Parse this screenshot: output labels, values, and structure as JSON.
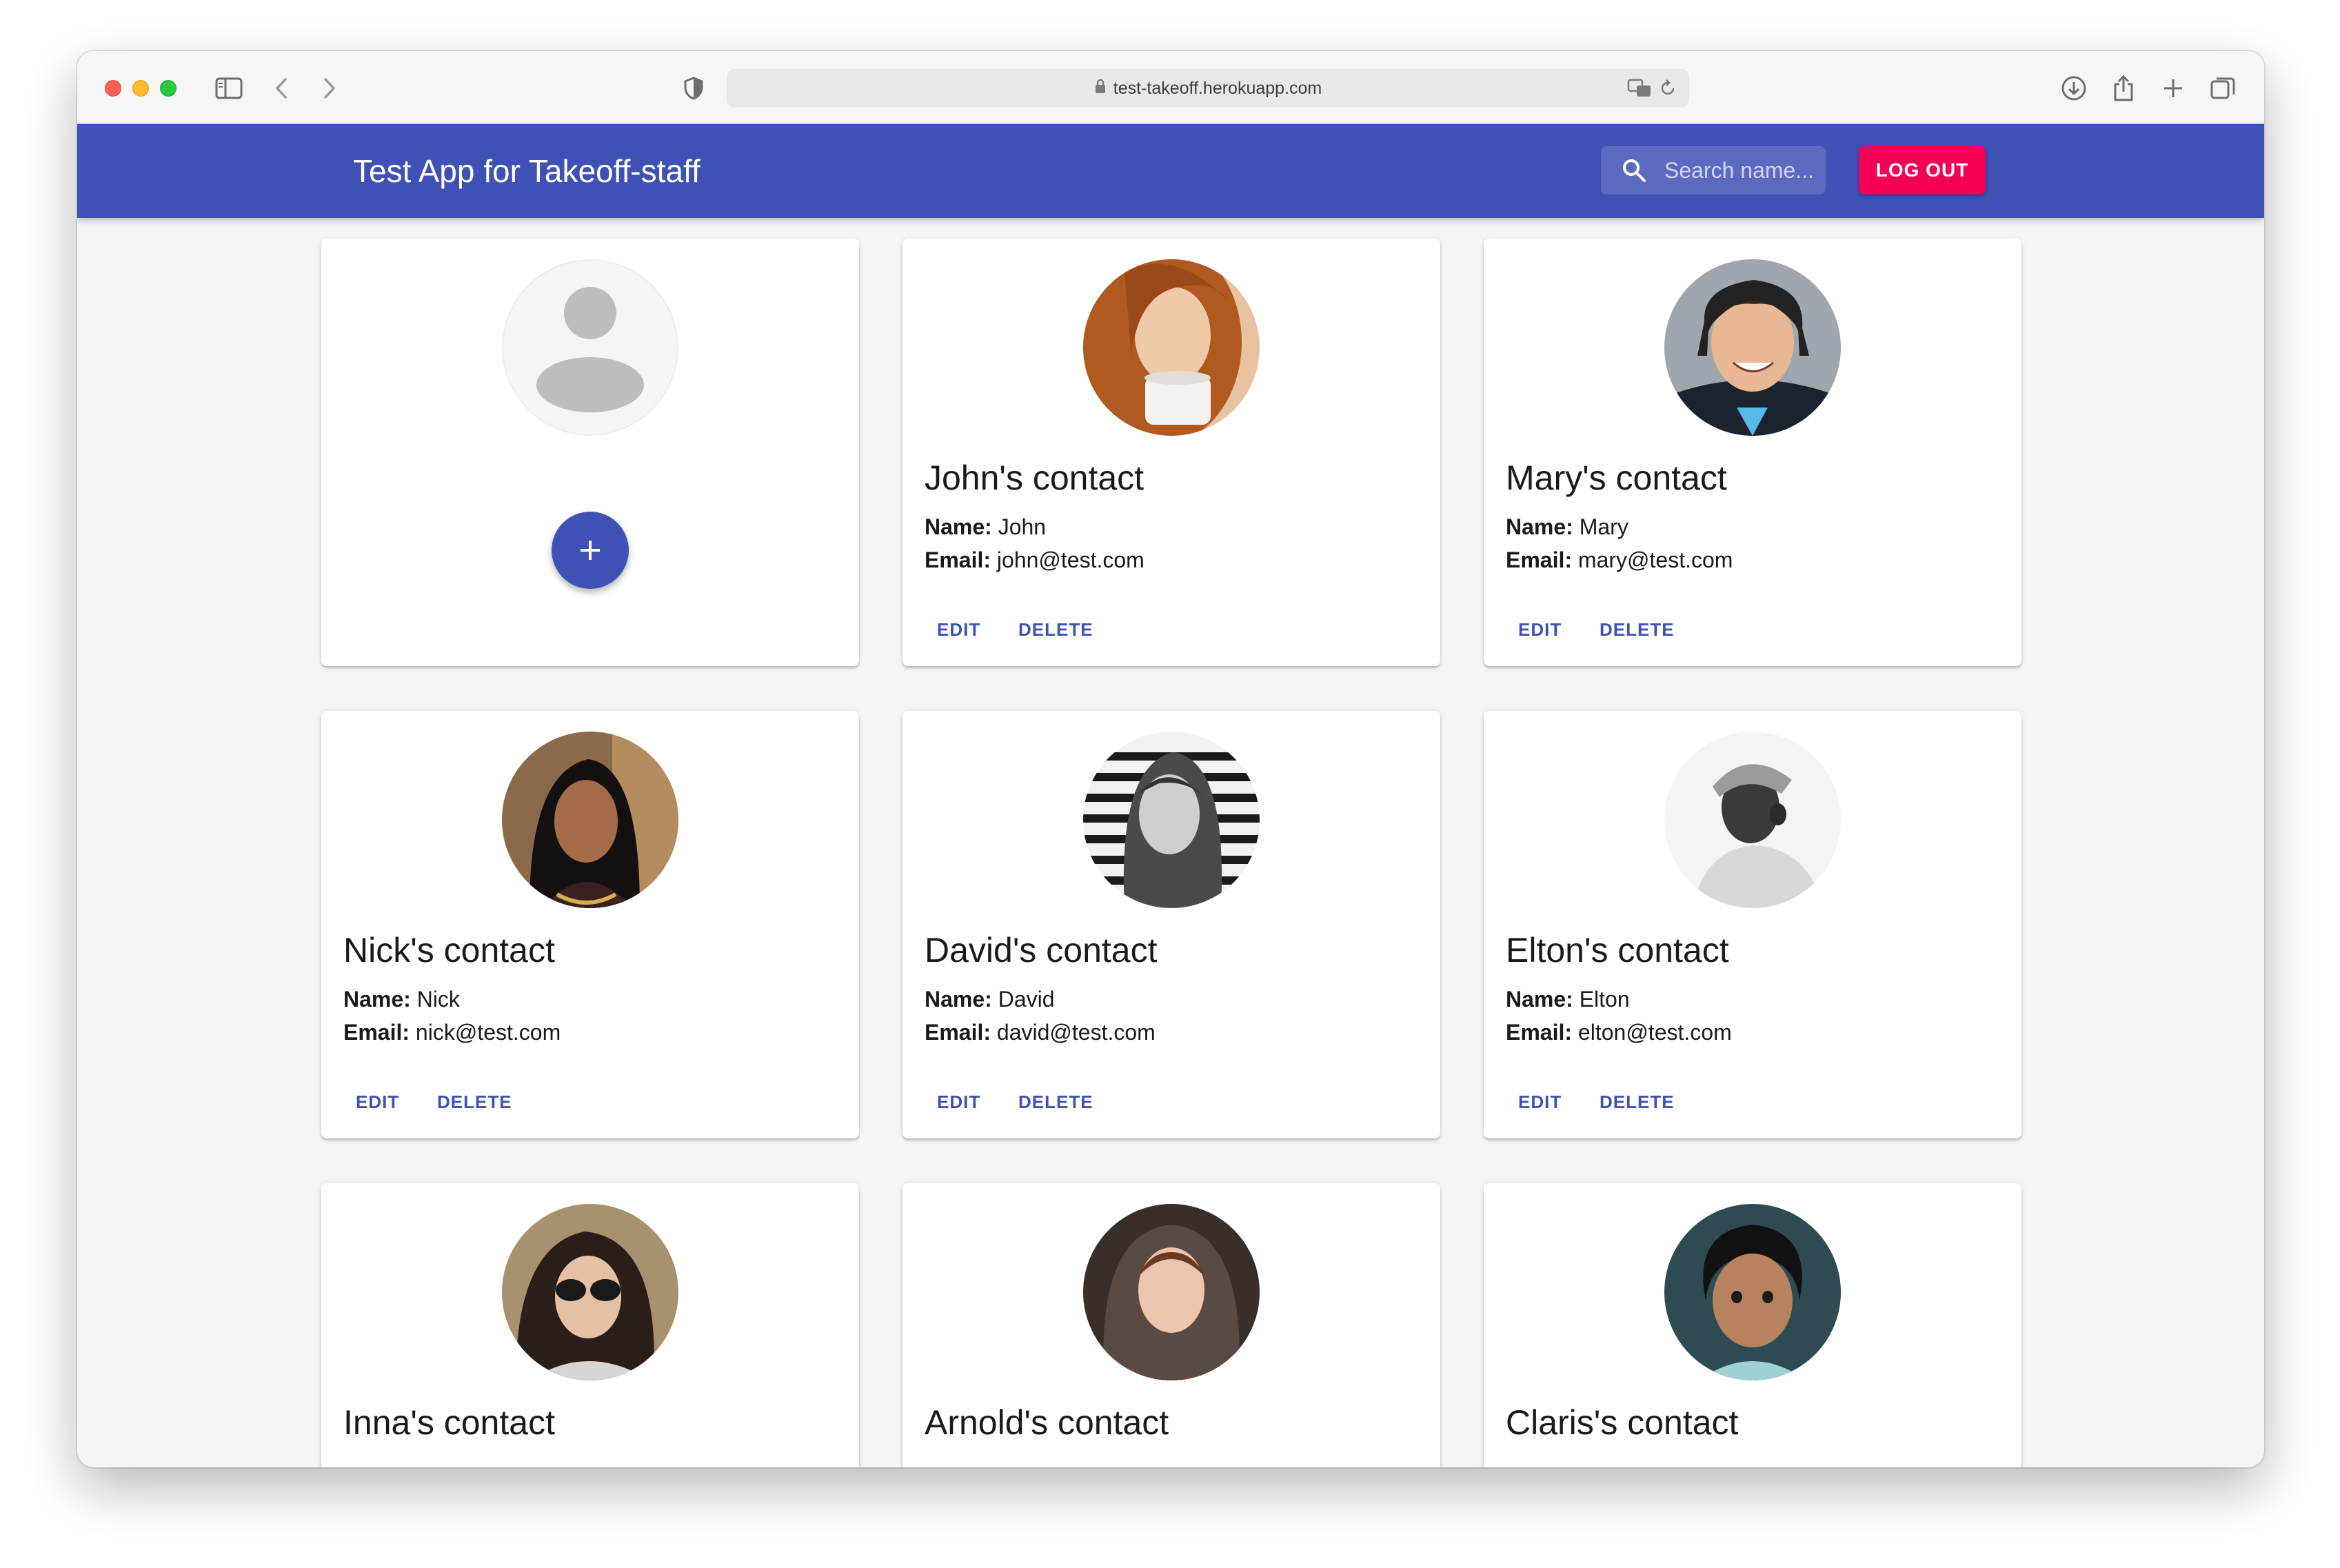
{
  "browser": {
    "url": "test-takeoff.herokuapp.com"
  },
  "app": {
    "title": "Test App for Takeoff-staff",
    "search_placeholder": "Search name...",
    "logout_label": "LOG OUT"
  },
  "labels": {
    "name": "Name:",
    "email": "Email:",
    "edit": "EDIT",
    "delete": "DELETE"
  },
  "contacts": [
    {
      "title": "John's contact",
      "name": "John",
      "email": "john@test.com"
    },
    {
      "title": "Mary's contact",
      "name": "Mary",
      "email": "mary@test.com"
    },
    {
      "title": "Nick's contact",
      "name": "Nick",
      "email": "nick@test.com"
    },
    {
      "title": "David's contact",
      "name": "David",
      "email": "david@test.com"
    },
    {
      "title": "Elton's contact",
      "name": "Elton",
      "email": "elton@test.com"
    },
    {
      "title": "Inna's contact"
    },
    {
      "title": "Arnold's contact"
    },
    {
      "title": "Claris's contact"
    }
  ],
  "colors": {
    "appbar": "#3f51b5",
    "logout": "#f50057",
    "accent": "#3f51b5"
  }
}
